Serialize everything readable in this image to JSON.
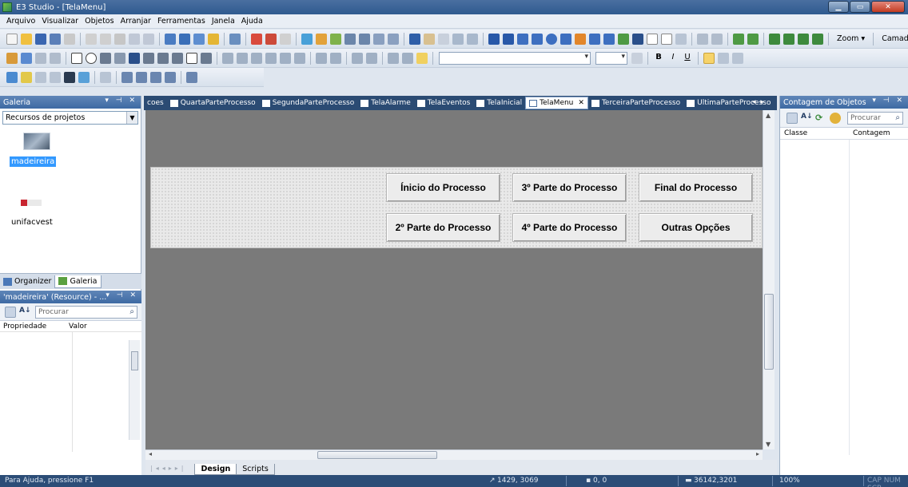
{
  "window": {
    "title": "E3 Studio - [TelaMenu]"
  },
  "menu": [
    "Arquivo",
    "Visualizar",
    "Objetos",
    "Arranjar",
    "Ferramentas",
    "Janela",
    "Ajuda"
  ],
  "toolbar": {
    "zoom_label": "Zoom ▾",
    "layers_label": "Camadas ▾"
  },
  "left_panel": {
    "title": "Galeria",
    "combo_value": "Recursos de projetos",
    "items": [
      {
        "label": "madeireira",
        "selected": true
      },
      {
        "label": "unifacvest",
        "selected": false
      }
    ],
    "tabs": [
      "Organizer",
      "Galeria"
    ]
  },
  "prop_panel": {
    "title": "'madeireira' (Resource) - ...",
    "search_placeholder": "Procurar",
    "col_property": "Propriedade",
    "col_value": "Valor"
  },
  "doc_tabs": [
    {
      "label": "coes",
      "active": false,
      "partial": true
    },
    {
      "label": "QuartaParteProcesso",
      "active": false
    },
    {
      "label": "SegundaParteProcesso",
      "active": false
    },
    {
      "label": "TelaAlarme",
      "active": false
    },
    {
      "label": "TelaEventos",
      "active": false
    },
    {
      "label": "TelaInicial",
      "active": false
    },
    {
      "label": "TelaMenu",
      "active": true
    },
    {
      "label": "TerceiraParteProcesso",
      "active": false
    },
    {
      "label": "UltimaParteProcesso",
      "active": false
    }
  ],
  "screen_buttons": {
    "inicio": "Ínicio do Processo",
    "terceira": "3º Parte do Processo",
    "final": "Final do Processo",
    "segunda": "2º Parte do Processo",
    "quarta": "4º Parte do Processo",
    "outras": "Outras Opções"
  },
  "sheet_tabs": [
    "Design",
    "Scripts"
  ],
  "right_panel": {
    "title": "Contagem de Objetos",
    "search_placeholder": "Procurar",
    "col_class": "Classe",
    "col_count": "Contagem"
  },
  "status": {
    "help": "Para Ajuda, pressione F1",
    "coords": "1429, 3069",
    "origin": "0, 0",
    "size": "36142,3201",
    "zoom": "100%",
    "indicators": "CAP NUM SCR"
  },
  "colors": {
    "canvas": "#7a7a7a",
    "panel_header": "#3e6aa3",
    "selection": "#3399ff",
    "statusbar": "#2c4d77"
  }
}
